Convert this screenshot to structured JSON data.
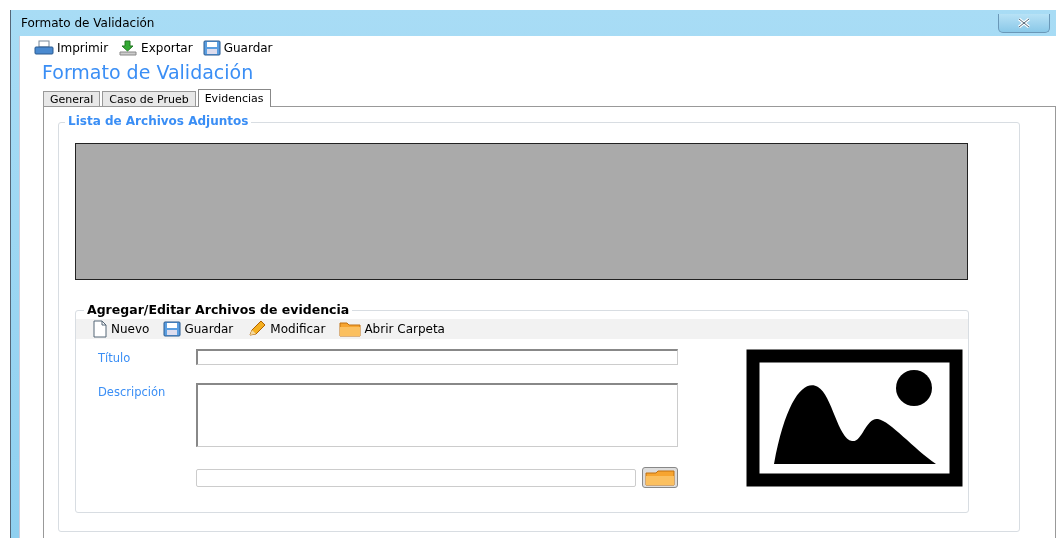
{
  "window": {
    "title": "Formato de Validación"
  },
  "toolbar": [
    {
      "label": "Imprimir",
      "kind": "print"
    },
    {
      "label": "Exportar",
      "kind": "export"
    },
    {
      "label": "Guardar",
      "kind": "save"
    }
  ],
  "heading": "Formato de Validación",
  "tabs": [
    {
      "label": "General",
      "selected": false
    },
    {
      "label": "Caso de Prueb",
      "selected": false
    },
    {
      "label": "Evidencias",
      "selected": true
    }
  ],
  "attachments": {
    "title": "Lista de Archivos Adjuntos"
  },
  "editor": {
    "title": "Agregar/Editar Archivos de evidencia",
    "toolbar": [
      {
        "label": "Nuevo",
        "kind": "new"
      },
      {
        "label": "Guardar",
        "kind": "save"
      },
      {
        "label": "Modificar",
        "kind": "edit"
      },
      {
        "label": "Abrir Carpeta",
        "kind": "folder"
      }
    ],
    "fields": [
      {
        "label": "Título",
        "kind": "line"
      },
      {
        "label": "Descripción",
        "kind": "area"
      }
    ]
  }
}
